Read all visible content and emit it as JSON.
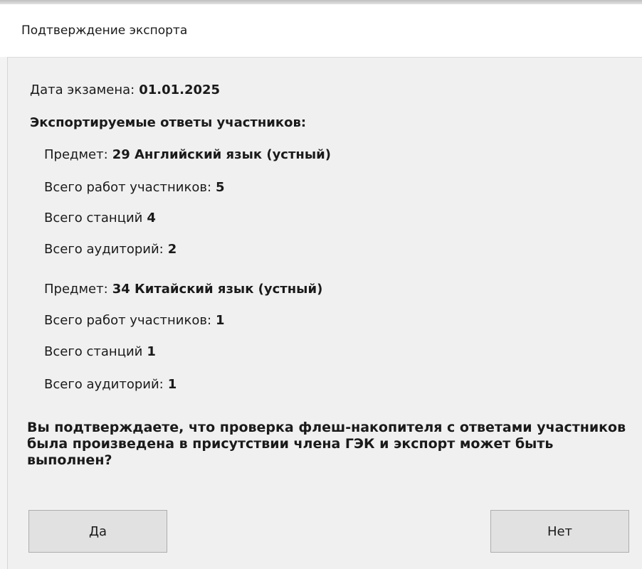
{
  "window": {
    "title": "Подтверждение экспорта"
  },
  "exam": {
    "date_label": "Дата экзамена:",
    "date_value": "01.01.2025",
    "section_heading": "Экспортируемые ответы участников:"
  },
  "subjects": [
    {
      "subject_label": "Предмет:",
      "subject_value": "29 Английский язык (устный)",
      "works_label": "Всего работ участников:",
      "works_value": "5",
      "stations_label": "Всего станций",
      "stations_value": "4",
      "rooms_label": "Всего аудиторий:",
      "rooms_value": "2"
    },
    {
      "subject_label": "Предмет:",
      "subject_value": "34 Китайский язык (устный)",
      "works_label": "Всего работ участников:",
      "works_value": "1",
      "stations_label": "Всего станций",
      "stations_value": "1",
      "rooms_label": "Всего аудиторий:",
      "rooms_value": "1"
    }
  ],
  "question": "Вы подтверждаете, что проверка флеш-накопителя с ответами участников была произведена в присутствии члена ГЭК и экспорт может быть выполнен?",
  "buttons": {
    "yes": "Да",
    "no": "Нет"
  }
}
